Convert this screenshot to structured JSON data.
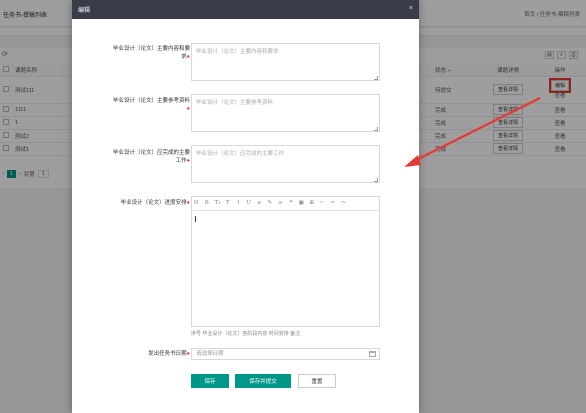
{
  "background": {
    "tab_title": "任务书-撰稿列表",
    "breadcrumb": "首页 / 任务书-撰稿列表",
    "columns": [
      "课题名称",
      "状态 ÷",
      "课题详情",
      "操作"
    ],
    "rows": [
      {
        "name": "测试111",
        "status": "待提交",
        "detail": "查看详情",
        "actions": [
          "编辑",
          "查看"
        ]
      },
      {
        "name": "1111",
        "status": "完成",
        "detail": "查看详情",
        "actions": [
          "查看"
        ]
      },
      {
        "name": "1",
        "status": "完成",
        "detail": "查看详情",
        "actions": [
          "查看"
        ]
      },
      {
        "name": "测试2",
        "status": "完成",
        "detail": "查看详情",
        "actions": [
          "查看"
        ]
      },
      {
        "name": "测试1",
        "status": "完成",
        "detail": "查看详情",
        "actions": [
          "查看"
        ]
      }
    ],
    "pager": {
      "current": "1",
      "goto_label": "到第",
      "goto_value": "1"
    }
  },
  "modal": {
    "title": "编辑",
    "close_icon": "close-icon",
    "fields": [
      {
        "label": "毕业设计（论文）主要内容和要求",
        "placeholder": "毕业设计（论文）主要内容和要求"
      },
      {
        "label": "毕业设计（论文）主要参考资料",
        "placeholder": "毕业设计（论文）主要参考资料"
      },
      {
        "label": "毕业设计（论文）应完成的主要工作",
        "placeholder": "毕业设计（论文）应完成的主要工作"
      }
    ],
    "progress_label": "毕业设计（论文）进度安排",
    "toolbar": [
      "H",
      "B",
      "Tı",
      "Ŧ",
      "I",
      "U",
      "⌀",
      "✎",
      "≡",
      "❝",
      "▣",
      "⊞",
      "⌐",
      "↶",
      "↷"
    ],
    "editor_hint": "序号 毕业设计（论文）各阶段内容 时间安排 备注",
    "date_label": "发出任务书日期",
    "date_placeholder": "请选择日期",
    "buttons": {
      "save": "保存",
      "save_submit": "保存并提交",
      "reset": "重置"
    }
  },
  "colors": {
    "accent": "#009688",
    "header": "#393d49",
    "required": "#e53935",
    "annotation": "#e53935"
  }
}
